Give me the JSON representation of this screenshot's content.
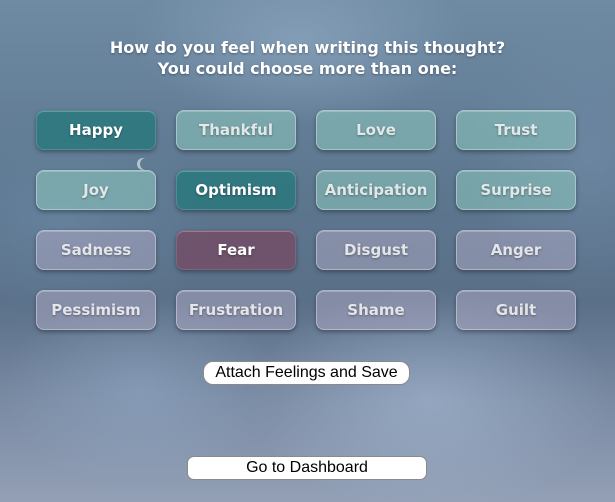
{
  "prompt": {
    "line1": "How do you feel when writing this thought?",
    "line2": "You could choose more than one:"
  },
  "feelings": {
    "happy": "Happy",
    "thankful": "Thankful",
    "love": "Love",
    "trust": "Trust",
    "joy": "Joy",
    "optimism": "Optimism",
    "anticipation": "Anticipation",
    "surprise": "Surprise",
    "sadness": "Sadness",
    "fear": "Fear",
    "disgust": "Disgust",
    "anger": "Anger",
    "pessimism": "Pessimism",
    "frustration": "Frustration",
    "shame": "Shame",
    "guilt": "Guilt"
  },
  "selected": [
    "Happy",
    "Optimism",
    "Fear"
  ],
  "actions": {
    "attach_label": "Attach Feelings and Save",
    "dashboard_label": "Go to Dashboard"
  },
  "colors": {
    "positive_chip": "#8cc8be",
    "negative_chip": "#afaac3",
    "selected_positive": "#28787d",
    "selected_negative": "#78465f"
  }
}
